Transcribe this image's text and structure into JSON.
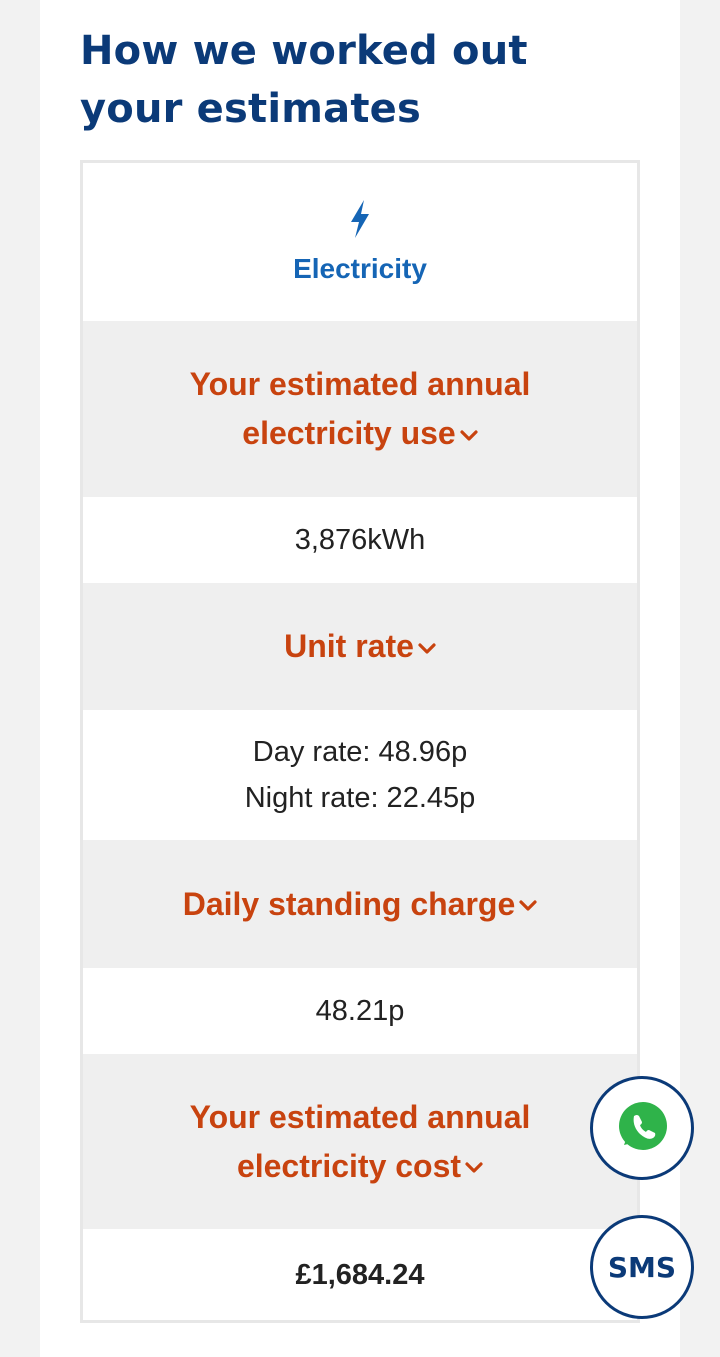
{
  "heading": "How we worked out your estimates",
  "fuel": {
    "label": "Electricity",
    "icon": "lightning-bolt-icon"
  },
  "sections": {
    "annual_use": {
      "label": "Your estimated annual electricity use",
      "value": "3,876kWh"
    },
    "unit_rate": {
      "label": "Unit rate",
      "day": "Day rate: 48.96p",
      "night": "Night rate: 22.45p"
    },
    "standing_charge": {
      "label": "Daily standing charge",
      "value": "48.21p"
    },
    "annual_cost": {
      "label": "Your estimated annual electricity cost",
      "value": "£1,684.24"
    }
  },
  "contact": {
    "whatsapp_icon": "whatsapp-icon",
    "sms_label": "SMS"
  },
  "colors": {
    "heading": "#0b3a78",
    "accent_orange": "#c8430f",
    "fuel_blue": "#1565b5",
    "row_grey": "#efefef",
    "whatsapp_green": "#2fb34a"
  }
}
